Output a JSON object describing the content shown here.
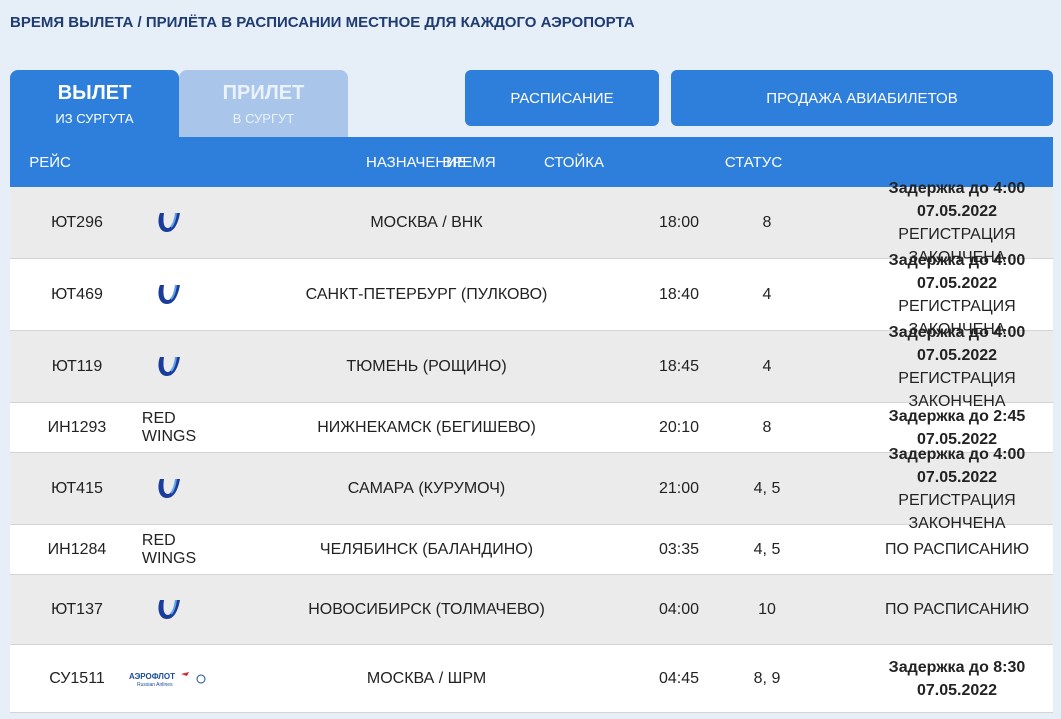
{
  "notice": "ВРЕМЯ ВЫЛЕТА / ПРИЛЁТА В РАСПИСАНИИ МЕСТНОЕ ДЛЯ КАЖДОГО АЭРОПОРТА",
  "tabs": [
    {
      "main": "ВЫЛЕТ",
      "sub": "ИЗ СУРГУТА"
    },
    {
      "main": "ПРИЛЕТ",
      "sub": "В СУРГУТ"
    }
  ],
  "buttons": {
    "schedule": "РАСПИСАНИЕ",
    "tickets": "ПРОДАЖА АВИАБИЛЕТОВ"
  },
  "columns": {
    "flight": "РЕЙС",
    "dest": "НАЗНАЧЕНИЕ",
    "time": "ВРЕМЯ",
    "counter": "СТОЙКА",
    "status": "СТАТУС"
  },
  "flights": [
    {
      "flight": "ЮТ296",
      "airline": "",
      "dest": "МОСКВА / ВНК",
      "time": "18:00",
      "counter": "8",
      "status1": "Задержка до 4:00 07.05.2022",
      "status2": "РЕГИСТРАЦИЯ ЗАКОНЧЕНА"
    },
    {
      "flight": "ЮТ469",
      "airline": "",
      "dest": "САНКТ-ПЕТЕРБУРГ (ПУЛКОВО)",
      "time": "18:40",
      "counter": "4",
      "status1": "Задержка до 4:00 07.05.2022",
      "status2": "РЕГИСТРАЦИЯ ЗАКОНЧЕНА"
    },
    {
      "flight": "ЮТ119",
      "airline": "",
      "dest": "ТЮМЕНЬ (РОЩИНО)",
      "time": "18:45",
      "counter": "4",
      "status1": "Задержка до 4:00 07.05.2022",
      "status2": "РЕГИСТРАЦИЯ ЗАКОНЧЕНА"
    },
    {
      "flight": "ИН1293",
      "airline": "RED WINGS",
      "dest": "НИЖНЕКАМСК (БЕГИШЕВО)",
      "time": "20:10",
      "counter": "8",
      "status1": "Задержка до 2:45 07.05.2022",
      "status2": ""
    },
    {
      "flight": "ЮТ415",
      "airline": "",
      "dest": "САМАРА (КУРУМОЧ)",
      "time": "21:00",
      "counter": "4, 5",
      "status1": "Задержка до 4:00 07.05.2022",
      "status2": "РЕГИСТРАЦИЯ ЗАКОНЧЕНА"
    },
    {
      "flight": "ИН1284",
      "airline": "RED WINGS",
      "dest": "ЧЕЛЯБИНСК (БАЛАНДИНО)",
      "time": "03:35",
      "counter": "4, 5",
      "status1": "",
      "status2": "ПО РАСПИСАНИЮ"
    },
    {
      "flight": "ЮТ137",
      "airline": "",
      "dest": "НОВОСИБИРСК (ТОЛМАЧЕВО)",
      "time": "04:00",
      "counter": "10",
      "status1": "",
      "status2": "ПО РАСПИСАНИЮ"
    },
    {
      "flight": "СУ1511",
      "airline": "АЭРОФЛОТ",
      "dest": "МОСКВА / ШРМ",
      "time": "04:45",
      "counter": "8, 9",
      "status1": "Задержка до 8:30 07.05.2022",
      "status2": ""
    }
  ],
  "logos": {
    "utair": "utair-u-logo",
    "aeroflot": "aeroflot-logo"
  },
  "colors": {
    "primary": "#2e7fdb",
    "inactive_tab": "#a9c5ea",
    "utair": "#1a3d9b",
    "aeroflot": "#1a4d9b"
  }
}
